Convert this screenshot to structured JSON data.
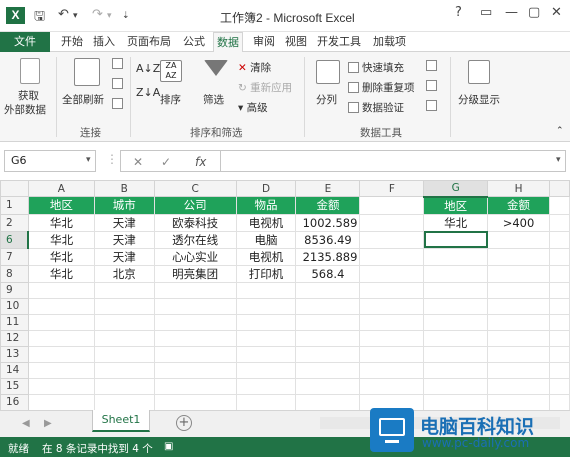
{
  "window": {
    "title": "工作簿2 - Microsoft Excel",
    "app_icon": "X",
    "qa_icons": [
      "save-icon",
      "undo-icon",
      "redo-icon"
    ],
    "controls": [
      "?",
      "▭",
      "—",
      "▢",
      "✕"
    ]
  },
  "tabs": [
    "文件",
    "开始",
    "插入",
    "页面布局",
    "公式",
    "数据",
    "审阅",
    "视图",
    "开发工具",
    "加载项"
  ],
  "active_tab": "数据",
  "ribbon": {
    "get_external": [
      "获取",
      "外部数据"
    ],
    "refresh_all": "全部刷新",
    "group_connections": "连接",
    "sort_label": "排序",
    "filter_label": "筛选",
    "clear_label": "清除",
    "reapply_label": "重新应用",
    "advanced_label": "高级",
    "group_sort_filter": "排序和筛选",
    "split_label": "分列",
    "flash_fill": "快速填充",
    "remove_dup": "删除重复项",
    "data_validation": "数据验证",
    "group_data_tools": "数据工具",
    "outline_label": "分级显示"
  },
  "formula_bar": {
    "name_box": "G6",
    "cancel": "✕",
    "enter": "✓",
    "fx": "fx",
    "formula": ""
  },
  "sheet": {
    "columns": [
      "A",
      "B",
      "C",
      "D",
      "E",
      "F",
      "G",
      "H"
    ],
    "rows": [
      "1",
      "2",
      "6",
      "7",
      "8",
      "9",
      "10",
      "11",
      "12",
      "13",
      "14",
      "15",
      "16",
      "17"
    ],
    "header_row": [
      "地区",
      "城市",
      "公司",
      "物品",
      "金额",
      "",
      "地区",
      "金额"
    ],
    "data": [
      [
        "华北",
        "天津",
        "欧泰科技",
        "电视机",
        "1002.589",
        "",
        "华北",
        ">400"
      ],
      [
        "华北",
        "天津",
        "透尔在线",
        "电脑",
        "8536.49",
        "",
        "",
        ""
      ],
      [
        "华北",
        "天津",
        "心心实业",
        "电视机",
        "2135.889",
        "",
        "",
        ""
      ],
      [
        "华北",
        "北京",
        "明亮集团",
        "打印机",
        "568.4",
        "",
        "",
        ""
      ]
    ],
    "selected_col": "G",
    "selected_row": "6"
  },
  "sheet_tabs": {
    "active": "Sheet1",
    "add": "+"
  },
  "status": {
    "ready": "就绪",
    "filter_info": "在 8 条记录中找到 4 个"
  },
  "watermark": {
    "brand": "电脑百科知识",
    "url": "www.pc-daily.com",
    "badge": "pc"
  },
  "colors": {
    "excel_green": "#217346",
    "header_fill": "#1fa25a"
  }
}
